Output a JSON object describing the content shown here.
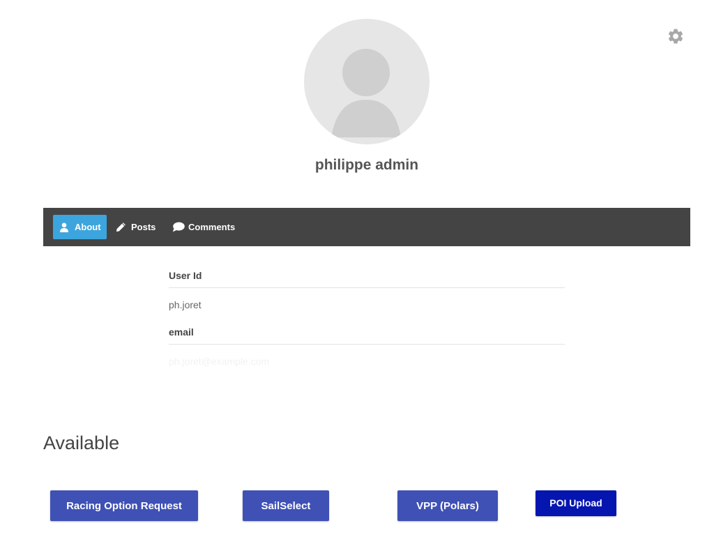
{
  "colors": {
    "tab_bar": "#444444",
    "tab_active": "#3da5dd",
    "button_primary": "#3f51b5",
    "button_dark": "#0515b0",
    "avatar_bg": "#e6e6e6",
    "gear": "#a8a8a8"
  },
  "header": {
    "settings_icon": "gear-icon"
  },
  "profile": {
    "avatar_icon": "user-placeholder-icon",
    "name": "philippe admin"
  },
  "tabs": [
    {
      "label": "About",
      "icon": "user-icon",
      "active": true
    },
    {
      "label": "Posts",
      "icon": "pencil-icon",
      "active": false
    },
    {
      "label": "Comments",
      "icon": "speech-bubble-icon",
      "active": false
    }
  ],
  "about": {
    "user_id_label": "User Id",
    "user_id_value": "ph.joret",
    "email_label": "email",
    "email_value": "ph.joret@example.com"
  },
  "available": {
    "title": "Available",
    "buttons": [
      {
        "label": "Racing Option Request"
      },
      {
        "label": "SailSelect"
      },
      {
        "label": "VPP (Polars)"
      },
      {
        "label": "POI Upload"
      }
    ]
  }
}
